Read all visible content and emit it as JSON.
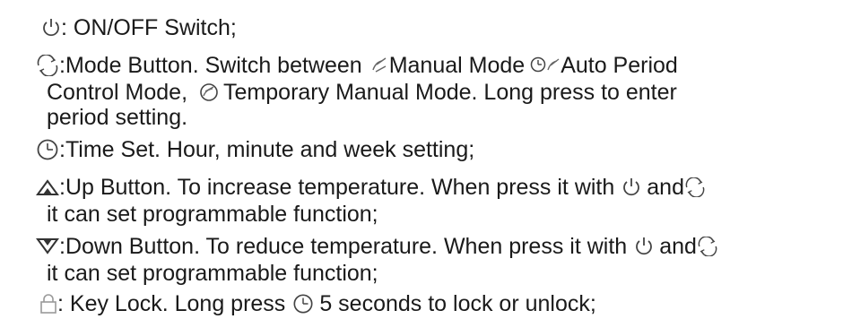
{
  "items": [
    {
      "icon": "power-icon",
      "lines": [
        ": ON/OFF Switch;"
      ]
    },
    {
      "icon": "mode-icon",
      "segments": {
        "a": ":Mode Button. Switch between",
        "b": " Manual Mode",
        "c": " Auto Period",
        "d": "Temporary Manual Mode. Long press to enter",
        "e": "Control Mode,"
      },
      "lines": [
        "period setting."
      ]
    },
    {
      "icon": "clock-icon",
      "lines": [
        ":Time Set. Hour, minute and week setting;"
      ]
    },
    {
      "icon": "up-triangle-icon",
      "lines": [
        ":Up Button. To increase temperature. When press it with",
        "and",
        "it can set programmable function;"
      ]
    },
    {
      "icon": "down-triangle-icon",
      "lines": [
        ":Down Button. To reduce temperature. When press it with",
        "and",
        "it can set programmable function;"
      ]
    },
    {
      "icon": "lock-icon",
      "lines": [
        ": Key Lock. Long press",
        "5 seconds to lock or unlock;"
      ]
    }
  ]
}
